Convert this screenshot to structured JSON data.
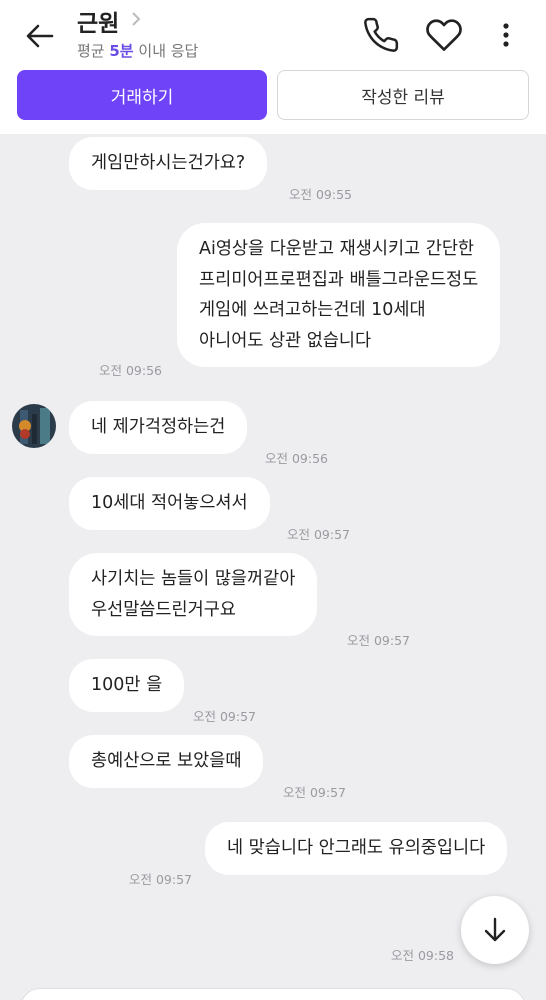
{
  "header": {
    "title": "근원",
    "response_prefix": "평균 ",
    "response_time": "5분",
    "response_suffix": " 이내 응답",
    "icons": [
      "back-arrow-icon",
      "chevron-right-icon",
      "phone-icon",
      "heart-icon",
      "more-vertical-icon"
    ]
  },
  "actions": {
    "trade_label": "거래하기",
    "review_label": "작성한 리뷰"
  },
  "messages": [
    {
      "side": "received",
      "lines": [
        "게임만하시는건가요?"
      ],
      "time": "오전 09:55"
    },
    {
      "side": "sent",
      "lines": [
        "Ai영상을 다운받고 재생시키고 간단한",
        "프리미어프로편집과 배틀그라운드정도",
        "게임에 쓰려고하는건데 10세대",
        "아니어도 상관 없습니다"
      ],
      "time": "오전 09:56"
    },
    {
      "side": "received",
      "lines": [
        "네 제가걱정하는건"
      ],
      "time": "오전 09:56"
    },
    {
      "side": "received",
      "lines": [
        "10세대 적어놓으셔서"
      ],
      "time": "오전 09:57"
    },
    {
      "side": "received",
      "lines": [
        "사기치는 놈들이 많을꺼같아",
        "우선말씀드린거구요"
      ],
      "time": "오전 09:57"
    },
    {
      "side": "received",
      "lines": [
        "100만 을"
      ],
      "time": "오전 09:57"
    },
    {
      "side": "received",
      "lines": [
        "총예산으로 보았을때"
      ],
      "time": "오전 09:57"
    },
    {
      "side": "sent",
      "lines": [
        "네 맞습니다 안그래도 유의중입니다"
      ],
      "time": "오전 09:57"
    }
  ],
  "last_time": "오전 09:58",
  "colors": {
    "accent": "#6f43f7",
    "chat_bg": "#eeeef1",
    "bubble": "#ffffff"
  }
}
